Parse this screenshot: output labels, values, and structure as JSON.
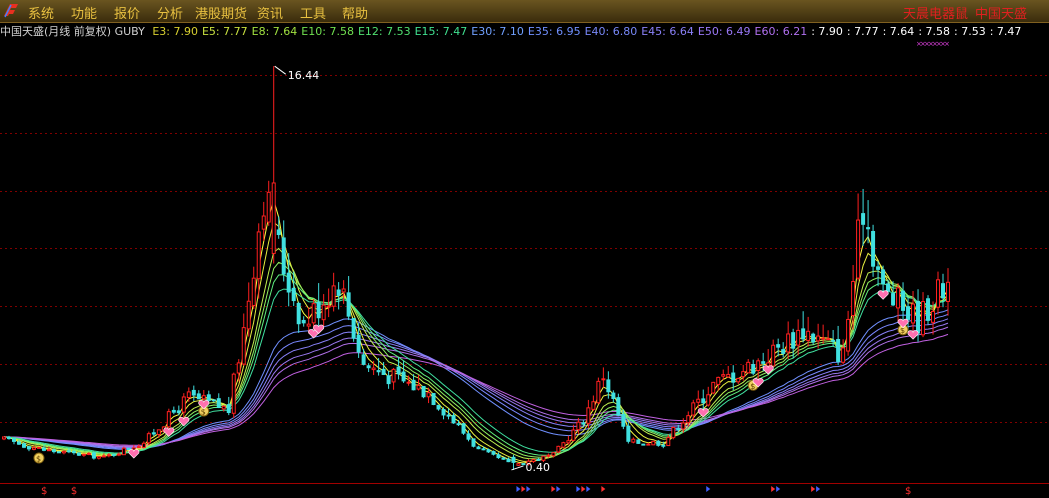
{
  "menu": {
    "items": [
      {
        "label": "系统"
      },
      {
        "label": "功能"
      },
      {
        "label": "报价"
      },
      {
        "label": "分析"
      },
      {
        "label": "港股期货"
      },
      {
        "label": "资讯"
      },
      {
        "label": "工具"
      },
      {
        "label": "帮助"
      }
    ],
    "right_items": [
      {
        "label": "天晨电器鼠"
      },
      {
        "label": "中国天盛"
      }
    ]
  },
  "indicator_bar": {
    "title": "中国天盛(月线 前复权) GUBY",
    "ma_values": [
      {
        "text": "E3: 7.90",
        "color": "#d8d030"
      },
      {
        "text": "E5: 7.77",
        "color": "#c8e040"
      },
      {
        "text": "E8: 7.64",
        "color": "#a0e040"
      },
      {
        "text": "E10: 7.58",
        "color": "#70e050"
      },
      {
        "text": "E12: 7.53",
        "color": "#50e070"
      },
      {
        "text": "E15: 7.47",
        "color": "#40e090"
      },
      {
        "text": "E30: 7.10",
        "color": "#70a0ff"
      },
      {
        "text": "E35: 6.95",
        "color": "#7090ff"
      },
      {
        "text": "E40: 6.80",
        "color": "#7888f8"
      },
      {
        "text": "E45: 6.64",
        "color": "#8a80f8"
      },
      {
        "text": "E50: 6.49",
        "color": "#9a78f8"
      },
      {
        "text": "E60: 6.21",
        "color": "#b070f0"
      },
      {
        "text": ": 7.90",
        "color": "#ffffff"
      },
      {
        "text": ": 7.77",
        "color": "#ffffff"
      },
      {
        "text": ": 7.64",
        "color": "#ffffff"
      },
      {
        "text": ": 7.58",
        "color": "#ffffff"
      },
      {
        "text": ": 7.53",
        "color": "#ffffff"
      },
      {
        "text": ": 7.47",
        "color": "#ffffff"
      }
    ],
    "text_color": "#c0c0c0"
  },
  "chart_data": {
    "type": "candlestick",
    "period": "monthly",
    "high_annotation": "16.44",
    "low_annotation": "0.40",
    "high_value": 16.44,
    "low_value": 0.4,
    "ylim": [
      0.0,
      17.4
    ],
    "grid": "horizontal dotted",
    "colors": {
      "up": "#ff2020",
      "down": "#40e0e0",
      "grid": "#800000",
      "background": "#000000"
    },
    "ribbon_short": [
      "E3",
      "E5",
      "E8",
      "E10",
      "E12",
      "E15"
    ],
    "ribbon_long": [
      "E30",
      "E35",
      "E40",
      "E45",
      "E50",
      "E60"
    ],
    "bars": 190,
    "seed": 17,
    "trend": [
      [
        0,
        1.6
      ],
      [
        8,
        1.2
      ],
      [
        20,
        0.9
      ],
      [
        28,
        1.5
      ],
      [
        37,
        3.3
      ],
      [
        45,
        2.8
      ],
      [
        48,
        6.0
      ],
      [
        52,
        11.5
      ],
      [
        56,
        8.5
      ],
      [
        60,
        6.2
      ],
      [
        67,
        8.0
      ],
      [
        72,
        4.6
      ],
      [
        85,
        3.5
      ],
      [
        95,
        1.2
      ],
      [
        102,
        0.6
      ],
      [
        110,
        1.0
      ],
      [
        116,
        2.4
      ],
      [
        120,
        4.2
      ],
      [
        125,
        1.5
      ],
      [
        132,
        1.5
      ],
      [
        142,
        3.8
      ],
      [
        152,
        4.8
      ],
      [
        160,
        6.0
      ],
      [
        168,
        5.0
      ],
      [
        172,
        11.0
      ],
      [
        176,
        7.5
      ],
      [
        183,
        6.4
      ],
      [
        189,
        7.9
      ]
    ],
    "markers": {
      "dollar_icon_bar_indices": [
        7,
        40,
        150,
        180
      ],
      "diamond_icon_bar_indices": [
        18,
        19,
        20,
        21,
        22,
        23,
        24,
        25,
        26,
        27,
        28,
        29,
        30,
        31,
        32,
        33,
        34,
        35,
        36,
        37,
        38,
        39
      ],
      "arrow_icon_bar_indices": [
        103,
        104,
        105,
        110,
        111,
        115,
        116,
        117,
        120,
        141,
        154,
        155,
        162,
        163
      ]
    }
  }
}
